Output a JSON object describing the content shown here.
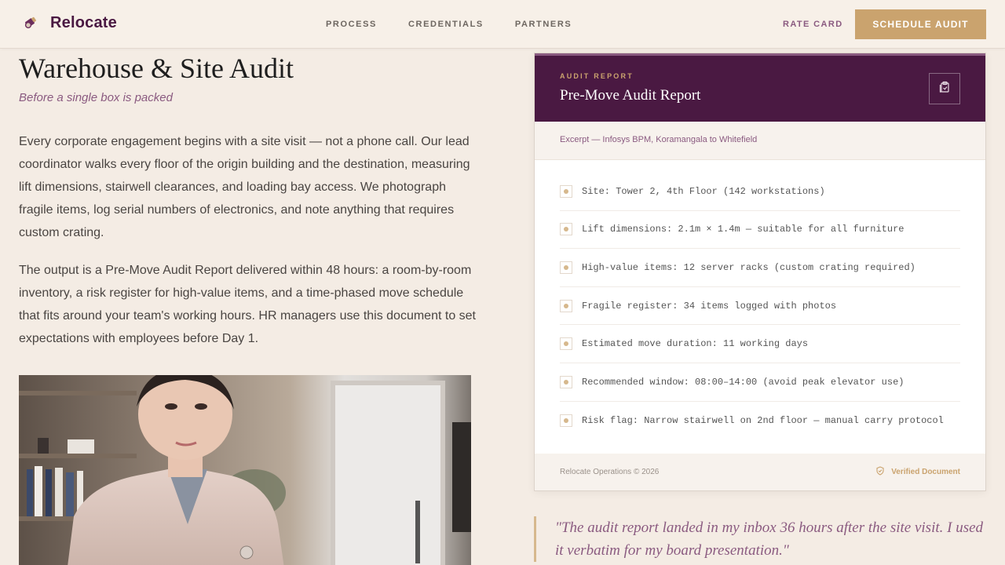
{
  "header": {
    "brand": "Relocate",
    "nav": [
      "PROCESS",
      "CREDENTIALS",
      "PARTNERS"
    ],
    "rate_card": "RATE CARD",
    "cta": "SCHEDULE AUDIT"
  },
  "main": {
    "title": "Warehouse & Site Audit",
    "subtitle": "Before a single box is packed",
    "paragraphs": [
      "Every corporate engagement begins with a site visit — not a phone call. Our lead coordinator walks every floor of the origin building and the destination, measuring lift dimensions, stairwell clearances, and loading bay access. We photograph fragile items, log serial numbers of electronics, and note anything that requires custom crating.",
      "The output is a Pre-Move Audit Report delivered within 48 hours: a room-by-room inventory, a risk register for high-value items, and a time-phased move schedule that fits around your team's working hours. HR managers use this document to set expectations with employees before Day 1."
    ]
  },
  "card": {
    "eyebrow": "AUDIT REPORT",
    "title": "Pre-Move Audit Report",
    "excerpt": "Excerpt — Infosys BPM, Koramangala to Whitefield",
    "rows": [
      "Site: Tower 2, 4th Floor (142 workstations)",
      "Lift dimensions: 2.1m × 1.4m — suitable for all furniture",
      "High-value items: 12 server racks (custom crating required)",
      "Fragile register: 34 items logged with photos",
      "Estimated move duration: 11 working days",
      "Recommended window: 08:00–14:00 (avoid peak elevator use)",
      "Risk flag: Narrow stairwell on 2nd floor — manual carry protocol"
    ],
    "footer_copy": "Relocate Operations © 2026",
    "verified": "Verified Document"
  },
  "quote": "\"The audit report landed in my inbox 36 hours after the site visit. I used it verbatim for my board presentation.\"",
  "colors": {
    "brand_plum": "#4a1942",
    "accent_gold": "#caa36e",
    "muted_plum": "#8a5a80",
    "background": "#f4ece4"
  },
  "icons": {
    "brand": "tape-gun-icon",
    "card_action": "clipboard-check-icon",
    "verified": "shield-check-icon"
  }
}
